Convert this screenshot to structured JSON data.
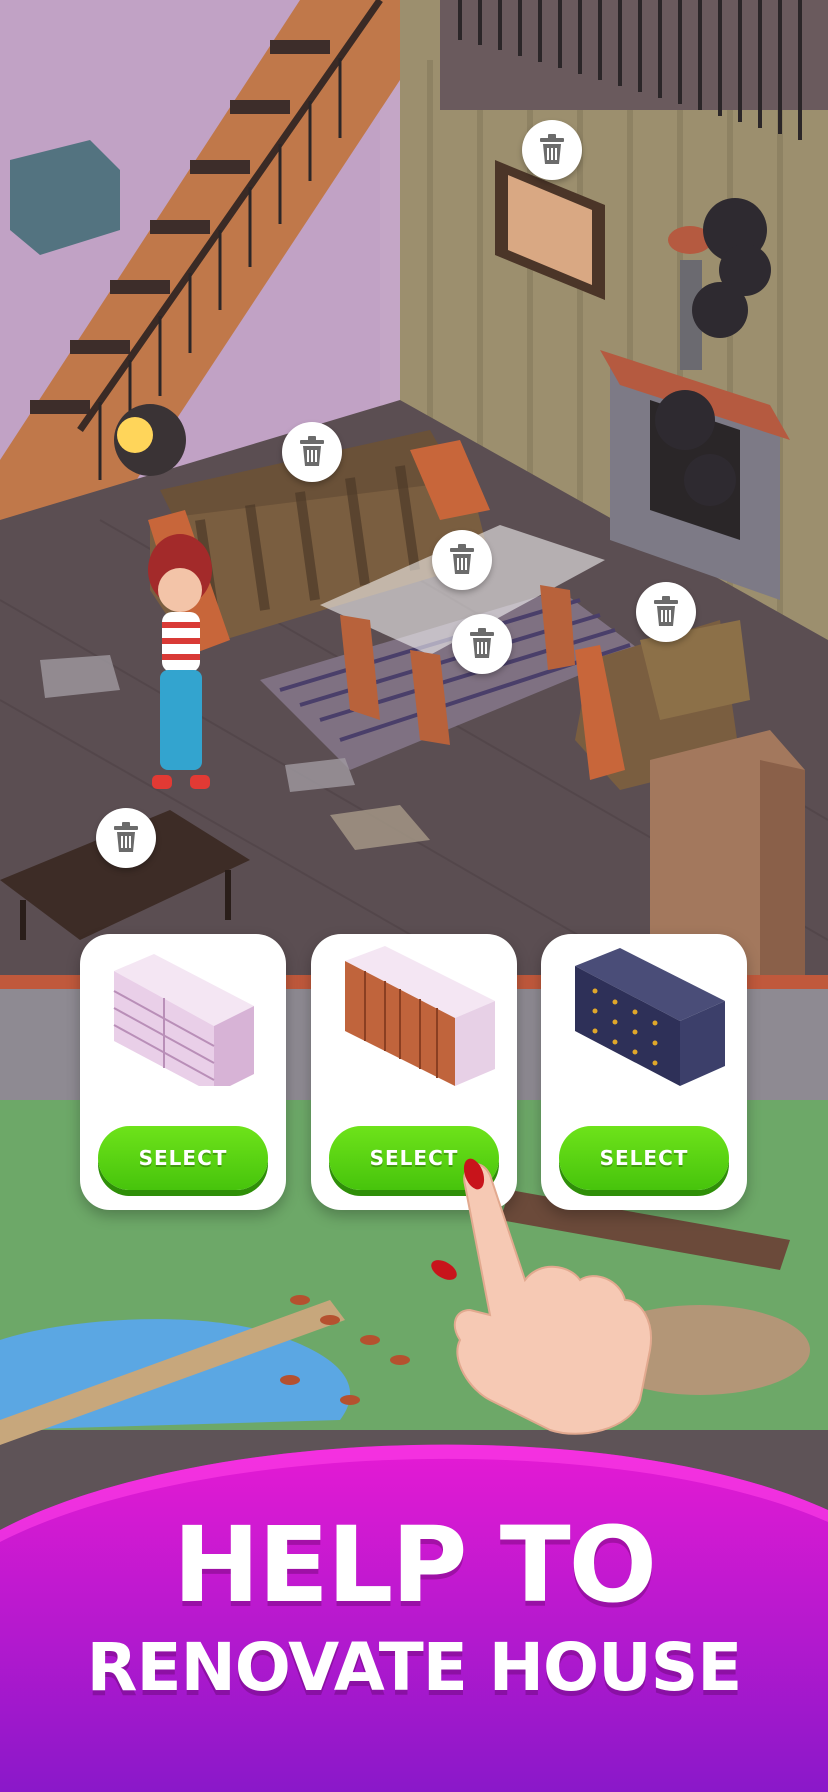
{
  "scene": {
    "trash_buttons": [
      {
        "label": "remove painting",
        "icon": "trash-icon"
      },
      {
        "label": "remove sofa",
        "icon": "trash-icon"
      },
      {
        "label": "remove table",
        "icon": "trash-icon"
      },
      {
        "label": "remove rug",
        "icon": "trash-icon"
      },
      {
        "label": "remove armchair",
        "icon": "trash-icon"
      },
      {
        "label": "remove coffee table",
        "icon": "trash-icon"
      }
    ]
  },
  "choices": [
    {
      "item": "pink dresser",
      "button": "SELECT"
    },
    {
      "item": "wooden dresser",
      "button": "SELECT"
    },
    {
      "item": "navy dresser",
      "button": "SELECT"
    }
  ],
  "banner": {
    "line1": "HELP TO",
    "line2": "RENOVATE HOUSE"
  },
  "colors": {
    "select_green": "#58d10f",
    "banner_magenta": "#e013d0",
    "banner_purple": "#8a18c9"
  }
}
